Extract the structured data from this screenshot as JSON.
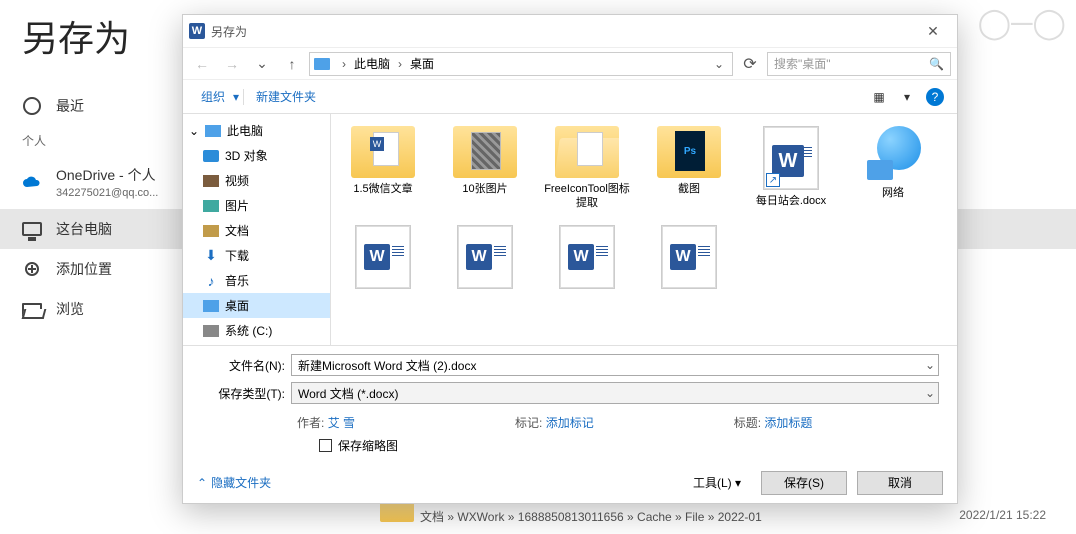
{
  "backstage": {
    "title": "另存为",
    "section_label": "个人",
    "items": [
      {
        "label": "最近",
        "icon": "clock"
      },
      {
        "label": "OneDrive - 个人",
        "sub": "342275021@qq.co...",
        "icon": "cloud"
      },
      {
        "label": "这台电脑",
        "icon": "monitor",
        "selected": true
      },
      {
        "label": "添加位置",
        "icon": "plus"
      },
      {
        "label": "浏览",
        "icon": "folder-open"
      }
    ]
  },
  "bg_file": {
    "name": "2022-01",
    "path": "文档 » WXWork » 1688850813011656 » Cache » File » 2022-01",
    "timestamp": "2022/1/21 15:22"
  },
  "dialog": {
    "title": "另存为",
    "breadcrumb": [
      "此电脑",
      "桌面"
    ],
    "search_placeholder": "搜索\"桌面\"",
    "cmd_organize": "组织",
    "cmd_newfolder": "新建文件夹",
    "tree": [
      {
        "label": "此电脑",
        "icon": "pc",
        "root": true
      },
      {
        "label": "3D 对象",
        "icon": "obj"
      },
      {
        "label": "视频",
        "icon": "vid"
      },
      {
        "label": "图片",
        "icon": "img"
      },
      {
        "label": "文档",
        "icon": "doc"
      },
      {
        "label": "下载",
        "icon": "dl"
      },
      {
        "label": "音乐",
        "icon": "mus"
      },
      {
        "label": "桌面",
        "icon": "desk",
        "selected": true
      },
      {
        "label": "系统 (C:)",
        "icon": "drv"
      }
    ],
    "files": [
      {
        "name": "1.5微信文章",
        "kind": "folder-word"
      },
      {
        "name": "10张图片",
        "kind": "folder-photo"
      },
      {
        "name": "FreeIconTool图标提取",
        "kind": "folder-open"
      },
      {
        "name": "截图",
        "kind": "folder-psd"
      },
      {
        "name": "每日站会.docx",
        "kind": "docx-shortcut"
      },
      {
        "name": "网络",
        "kind": "network"
      },
      {
        "name": "",
        "kind": "docx"
      },
      {
        "name": "",
        "kind": "docx"
      },
      {
        "name": "",
        "kind": "docx"
      },
      {
        "name": "",
        "kind": "docx"
      }
    ],
    "filename_label": "文件名(N):",
    "filename_value": "新建Microsoft Word 文档 (2).docx",
    "filetype_label": "保存类型(T):",
    "filetype_value": "Word 文档 (*.docx)",
    "author_label": "作者:",
    "author_value": "艾 雪",
    "tags_label": "标记:",
    "tags_value": "添加标记",
    "title_label": "标题:",
    "title_value": "添加标题",
    "thumb_chk": "保存缩略图",
    "hide_folders": "隐藏文件夹",
    "tools": "工具(L)",
    "save": "保存(S)",
    "cancel": "取消"
  }
}
